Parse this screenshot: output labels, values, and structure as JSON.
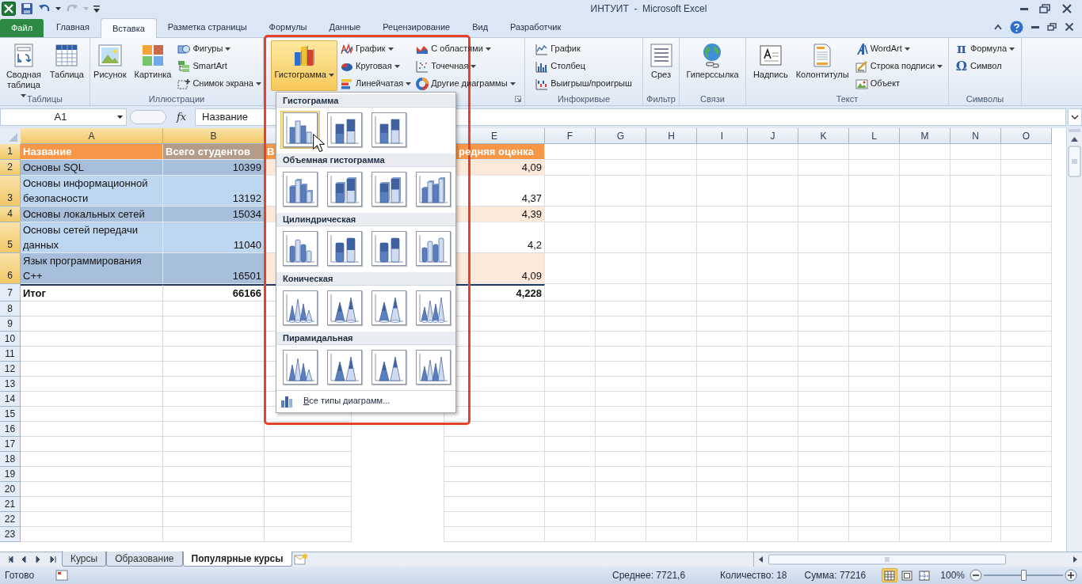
{
  "window": {
    "title": "ИНТУИТ  -  Microsoft Excel"
  },
  "tabs": [
    {
      "label": "Файл",
      "kind": "file",
      "selected": false
    },
    {
      "label": "Главная",
      "kind": "tab",
      "selected": false
    },
    {
      "label": "Вставка",
      "kind": "tab",
      "selected": true
    },
    {
      "label": "Разметка страницы",
      "kind": "tab",
      "selected": false
    },
    {
      "label": "Формулы",
      "kind": "tab",
      "selected": false
    },
    {
      "label": "Данные",
      "kind": "tab",
      "selected": false
    },
    {
      "label": "Рецензирование",
      "kind": "tab",
      "selected": false
    },
    {
      "label": "Вид",
      "kind": "tab",
      "selected": false
    },
    {
      "label": "Разработчик",
      "kind": "tab",
      "selected": false
    }
  ],
  "ribbon": {
    "groups": [
      {
        "label": "Таблицы",
        "launcher": false,
        "items": [
          {
            "kind": "large",
            "label": "Сводная\nтаблица",
            "dropdown": true,
            "pressed": false
          },
          {
            "kind": "large",
            "label": "Таблица",
            "dropdown": false,
            "pressed": false
          }
        ]
      },
      {
        "label": "Иллюстрации",
        "launcher": false,
        "items": [
          {
            "kind": "large",
            "label": "Рисунок",
            "dropdown": false,
            "pressed": false
          },
          {
            "kind": "large",
            "label": "Картинка",
            "dropdown": false,
            "pressed": false
          },
          {
            "kind": "small",
            "label": "Фигуры",
            "dropdown": true,
            "pressed": false
          },
          {
            "kind": "small",
            "label": "SmartArt",
            "dropdown": false,
            "pressed": false
          },
          {
            "kind": "small",
            "label": "Снимок экрана",
            "dropdown": true,
            "pressed": false
          }
        ]
      },
      {
        "launcher": true,
        "items": [
          {
            "kind": "large",
            "label": "Гистограмма",
            "dropdown": true,
            "pressed": true
          },
          {
            "kind": "small",
            "label": "График",
            "dropdown": true,
            "pressed": false
          },
          {
            "kind": "small",
            "label": "Круговая",
            "dropdown": true,
            "pressed": false
          },
          {
            "kind": "small",
            "label": "Линейчатая",
            "dropdown": true,
            "pressed": false
          },
          {
            "kind": "small",
            "label": "С областями",
            "dropdown": true,
            "pressed": false
          },
          {
            "kind": "small",
            "label": "Точечная",
            "dropdown": true,
            "pressed": false
          },
          {
            "kind": "small",
            "label": "Другие диаграммы",
            "dropdown": true,
            "pressed": false
          }
        ]
      },
      {
        "label": "Инфокривые",
        "launcher": false,
        "items": [
          {
            "kind": "small",
            "label": "График",
            "dropdown": false,
            "pressed": false
          },
          {
            "kind": "small",
            "label": "Столбец",
            "dropdown": false,
            "pressed": false
          },
          {
            "kind": "small",
            "label": "Выигрыш/проигрыш",
            "dropdown": false,
            "pressed": false
          }
        ]
      },
      {
        "label": "Фильтр",
        "launcher": false,
        "items": [
          {
            "kind": "large",
            "label": "Срез",
            "dropdown": false,
            "pressed": false
          }
        ]
      },
      {
        "label": "Связи",
        "launcher": false,
        "items": [
          {
            "kind": "large",
            "label": "Гиперссылка",
            "dropdown": false,
            "pressed": false
          }
        ]
      },
      {
        "label": "Текст",
        "launcher": false,
        "items": [
          {
            "kind": "large",
            "label": "Надпись",
            "dropdown": false,
            "pressed": false
          },
          {
            "kind": "large",
            "label": "Колонтитулы",
            "dropdown": false,
            "pressed": false
          },
          {
            "kind": "small",
            "label": "WordArt",
            "dropdown": true,
            "pressed": false
          },
          {
            "kind": "small",
            "label": "Строка подписи",
            "dropdown": true,
            "pressed": false
          },
          {
            "kind": "small",
            "label": "Объект",
            "dropdown": false,
            "pressed": false
          }
        ]
      },
      {
        "label": "Символы",
        "launcher": false,
        "items": [
          {
            "kind": "small",
            "glyph": "π",
            "label": "Формула",
            "dropdown": true,
            "pressed": false
          },
          {
            "kind": "small",
            "glyph": "Ω",
            "label": "Символ",
            "dropdown": false,
            "pressed": false
          }
        ]
      }
    ]
  },
  "formula_bar": {
    "name_box": "A1",
    "fx": "fx",
    "value": "Название"
  },
  "columns": [
    {
      "label": "A",
      "selected": true
    },
    {
      "label": "B",
      "selected": true
    },
    {
      "selected": false
    },
    {
      "label": "E",
      "selected": false
    },
    {
      "label": "F",
      "selected": false
    },
    {
      "label": "G",
      "selected": false
    },
    {
      "label": "H",
      "selected": false
    },
    {
      "label": "I",
      "selected": false
    },
    {
      "label": "J",
      "selected": false
    },
    {
      "label": "K",
      "selected": false
    },
    {
      "label": "L",
      "selected": false
    },
    {
      "label": "M",
      "selected": false
    },
    {
      "label": "N",
      "selected": false
    },
    {
      "label": "O",
      "selected": false
    }
  ],
  "rows": [
    {
      "label": "1",
      "kind": "header",
      "selected": true,
      "cells": {
        "A": "Название",
        "B": "Всего студентов",
        "C": "В",
        "E": "редняя оценка"
      }
    },
    {
      "label": "2",
      "kind": "data",
      "banded": true,
      "selected": true,
      "cells": {
        "A": "Основы SQL",
        "B": "10399",
        "E": "4,09"
      }
    },
    {
      "label": "3",
      "kind": "data",
      "banded": false,
      "selected": true,
      "cells": {
        "A": "Основы информационной\nбезопасности",
        "B": "13192",
        "E": "4,37"
      }
    },
    {
      "label": "4",
      "kind": "data",
      "banded": true,
      "selected": true,
      "cells": {
        "A": "Основы локальных сетей",
        "B": "15034",
        "E": "4,39"
      }
    },
    {
      "label": "5",
      "kind": "data",
      "banded": false,
      "selected": true,
      "cells": {
        "A": "Основы сетей передачи\nданных",
        "B": "11040",
        "E": "4,2"
      }
    },
    {
      "label": "6",
      "kind": "data",
      "banded": true,
      "selected": true,
      "cells": {
        "A": "Язык программирования\nC++",
        "B": "16501",
        "E": "4,09"
      }
    },
    {
      "label": "7",
      "kind": "total",
      "selected": false,
      "cells": {
        "A": "Итог",
        "B": "66166",
        "E": "4,228"
      }
    },
    {
      "label": "8",
      "kind": "empty",
      "selected": false,
      "cells": {}
    },
    {
      "label": "9",
      "kind": "empty",
      "selected": false,
      "cells": {}
    },
    {
      "label": "10",
      "kind": "empty",
      "selected": false,
      "cells": {}
    },
    {
      "label": "11",
      "kind": "empty",
      "selected": false,
      "cells": {}
    },
    {
      "label": "12",
      "kind": "empty",
      "selected": false,
      "cells": {}
    },
    {
      "label": "13",
      "kind": "empty",
      "selected": false,
      "cells": {}
    },
    {
      "label": "14",
      "kind": "empty",
      "selected": false,
      "cells": {}
    },
    {
      "label": "15",
      "kind": "empty",
      "selected": false,
      "cells": {}
    },
    {
      "label": "16",
      "kind": "empty",
      "selected": false,
      "cells": {}
    },
    {
      "label": "17",
      "kind": "empty",
      "selected": false,
      "cells": {}
    },
    {
      "label": "18",
      "kind": "empty",
      "selected": false,
      "cells": {}
    },
    {
      "label": "19",
      "kind": "empty",
      "selected": false,
      "cells": {}
    },
    {
      "label": "20",
      "kind": "empty",
      "selected": false,
      "cells": {}
    },
    {
      "label": "21",
      "kind": "empty",
      "selected": false,
      "cells": {}
    },
    {
      "label": "22",
      "kind": "empty",
      "selected": false,
      "cells": {}
    },
    {
      "label": "23",
      "kind": "empty",
      "selected": false,
      "cells": {}
    }
  ],
  "chart_menu": {
    "sections": [
      {
        "title": "Гистограмма",
        "kind": "column",
        "options": [
          {
            "selected": true
          },
          {
            "selected": false
          },
          {
            "selected": false
          }
        ]
      },
      {
        "title": "Объемная гистограмма",
        "kind": "column3d",
        "options": [
          {
            "selected": false
          },
          {
            "selected": false
          },
          {
            "selected": false
          },
          {
            "selected": false
          }
        ]
      },
      {
        "title": "Цилиндрическая",
        "kind": "cylinder",
        "options": [
          {
            "selected": false
          },
          {
            "selected": false
          },
          {
            "selected": false
          },
          {
            "selected": false
          }
        ]
      },
      {
        "title": "Коническая",
        "kind": "cone",
        "options": [
          {
            "selected": false
          },
          {
            "selected": false
          },
          {
            "selected": false
          },
          {
            "selected": false
          }
        ]
      },
      {
        "title": "Пирамидальная",
        "kind": "pyramid",
        "options": [
          {
            "selected": false
          },
          {
            "selected": false
          },
          {
            "selected": false
          },
          {
            "selected": false
          }
        ]
      }
    ],
    "footer": "Все типы диаграмм..."
  },
  "sheet_tabs": [
    {
      "label": "Курсы",
      "selected": false
    },
    {
      "label": "Образование",
      "selected": false
    },
    {
      "label": "Популярные курсы",
      "selected": true
    }
  ],
  "status_bar": {
    "mode": "Готово",
    "average": "Среднее: 7721,6",
    "count": "Количество: 18",
    "sum": "Сумма: 77216",
    "views": [
      {
        "kind": "normal",
        "selected": true
      },
      {
        "kind": "layout",
        "selected": false
      },
      {
        "kind": "pagebreak",
        "selected": false
      }
    ],
    "zoom": {
      "label": "100%",
      "level": 0.5
    }
  }
}
